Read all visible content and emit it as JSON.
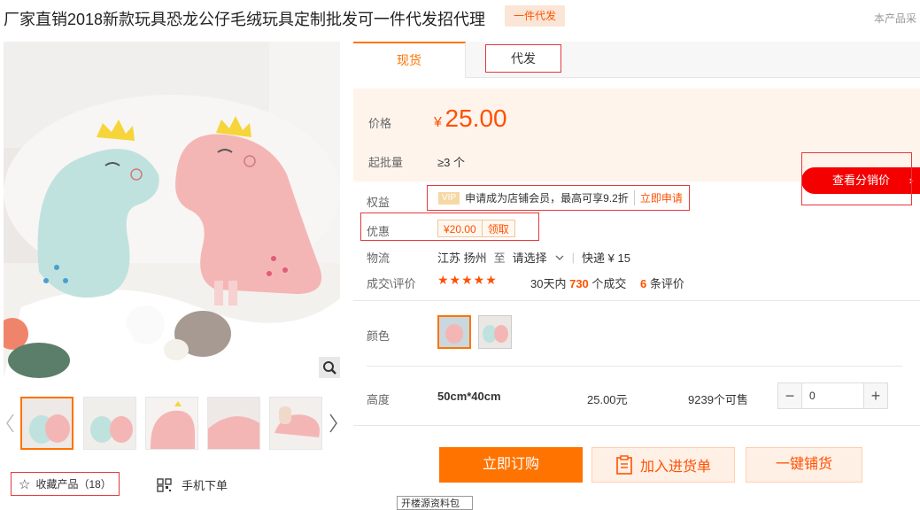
{
  "product": {
    "title": "厂家直销2018新款玩具恐龙公仔毛绒玩具定制批发可一件代发招代理",
    "dropship_tag": "一件代发",
    "purchase_note": "本产品采"
  },
  "gallery": {
    "favorite_label": "收藏产品（18）",
    "mobile_order_label": "手机下单",
    "thumbs": [
      "thumb-1",
      "thumb-2",
      "thumb-3",
      "thumb-4",
      "thumb-5"
    ]
  },
  "tabs": {
    "spot": "现货",
    "dropship": "代发"
  },
  "price": {
    "label": "价格",
    "currency": "¥",
    "value": "25.00",
    "moq_label": "起批量",
    "moq_value": "≥3 个"
  },
  "distributor_button": "查看分销价",
  "rights": {
    "label": "权益",
    "vip_badge": "VIP",
    "text": "申请成为店铺会员，最高可享9.2折",
    "apply": "立即申请"
  },
  "promo": {
    "label": "优惠",
    "coupon_value": "¥20.00",
    "coupon_claim": "领取"
  },
  "logistics": {
    "label": "物流",
    "origin": "江苏 扬州",
    "to": "至",
    "dest": "请选择",
    "express": "快递 ¥ 15"
  },
  "deals": {
    "label": "成交\\评价",
    "rating_stars": "★★★★★",
    "month_prefix": "30天内",
    "month_count": "730",
    "month_suffix": "个成交",
    "review_count": "6",
    "review_suffix": "条评价"
  },
  "color": {
    "label": "颜色"
  },
  "sku": {
    "label": "高度",
    "size": "50cm*40cm",
    "price": "25.00元",
    "stock": "9239个可售",
    "minus": "−",
    "quantity": "0",
    "plus": "+"
  },
  "actions": {
    "order": "立即订购",
    "cart": "加入进货单",
    "distribute": "一键铺货"
  },
  "tooltip": "开楼源资料包"
}
